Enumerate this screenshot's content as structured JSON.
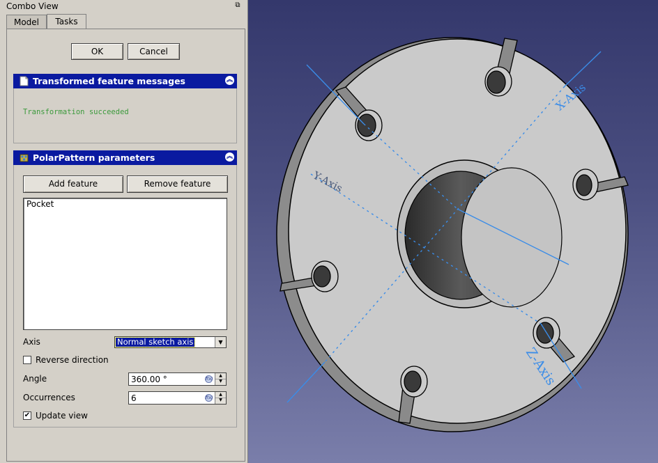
{
  "window": {
    "title": "Combo View"
  },
  "tabs": [
    {
      "label": "Model",
      "active": false
    },
    {
      "label": "Tasks",
      "active": true
    }
  ],
  "dialog": {
    "ok_label": "OK",
    "cancel_label": "Cancel"
  },
  "messages_section": {
    "title": "Transformed feature messages",
    "message": "Transformation succeeded"
  },
  "params_section": {
    "title": "PolarPattern parameters",
    "add_feature_label": "Add feature",
    "remove_feature_label": "Remove feature",
    "features": [
      "Pocket"
    ],
    "axis_label": "Axis",
    "axis_value": "Normal sketch axis",
    "reverse_label": "Reverse direction",
    "reverse_checked": false,
    "angle_label": "Angle",
    "angle_value": "360.00 °",
    "occurrences_label": "Occurrences",
    "occurrences_value": "6",
    "update_view_label": "Update view",
    "update_view_checked": true
  },
  "viewport": {
    "axis_labels": {
      "x": "X-Axis",
      "y": "Y-Axis",
      "z": "Z-Axis"
    },
    "colors": {
      "axis_line": "#3a8ce8",
      "part_face": "#c8c8c8",
      "background_top": "#34386c",
      "background_bottom": "#7a7eaa",
      "header_blue": "#0a1aa0",
      "message_green": "#3c9a3c"
    }
  },
  "icons": {
    "float": "float-window-icon",
    "messages": "document-icon",
    "params": "polar-pattern-icon",
    "collapse": "collapse-chevron-icon",
    "fx": "expression-fx-icon"
  }
}
